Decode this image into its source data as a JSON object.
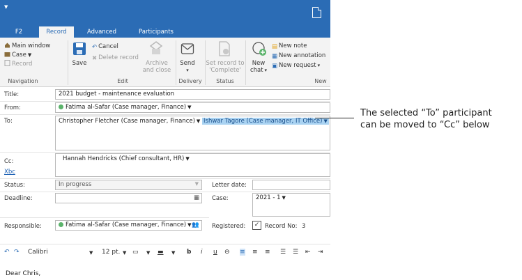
{
  "tabs": [
    {
      "label": "F2"
    },
    {
      "label": "Record"
    },
    {
      "label": "Advanced"
    },
    {
      "label": "Participants"
    }
  ],
  "ribbon": {
    "navigation": {
      "group_label": "Navigation",
      "main_window": "Main window",
      "case": "Case",
      "record": "Record"
    },
    "edit": {
      "group_label": "Edit",
      "save": "Save",
      "cancel": "Cancel",
      "delete_record": "Delete record",
      "archive_line1": "Archive",
      "archive_line2": "and close"
    },
    "delivery": {
      "group_label": "Delivery",
      "send": "Send"
    },
    "status": {
      "group_label": "Status",
      "set_line1": "Set record to",
      "set_line2": "'Complete'"
    },
    "new": {
      "group_label": "New",
      "new_chat_line1": "New",
      "new_chat_line2": "chat",
      "new_note": "New note",
      "new_annotation": "New annotation",
      "new_request": "New request"
    }
  },
  "form": {
    "title_label": "Title:",
    "title_value": "2021 budget - maintenance evaluation",
    "from_label": "From:",
    "from_value": "Fatima al-Safar (Case manager, Finance)",
    "to_label": "To:",
    "to_recipient_1": "Christopher Fletcher (Case manager, Finance)",
    "to_recipient_2": "Ishwar Tagore (Case manager, IT Office)",
    "cc_label": "Cc:",
    "cc_value": "Hannah Hendricks (Chief consultant, HR)",
    "xbc_label": "Xbc",
    "status_label": "Status:",
    "status_value": "In progress",
    "letter_date_label": "Letter date:",
    "deadline_label": "Deadline:",
    "case_label": "Case:",
    "case_value": "2021 - 1",
    "responsible_label": "Responsible:",
    "responsible_value": "Fatima al-Safar (Case manager, Finance)",
    "registered_label": "Registered:",
    "record_no_label": "Record No:",
    "record_no_value": "3"
  },
  "editor": {
    "font": "Calibri",
    "size": "12 pt.",
    "bold": "b",
    "italic": "i",
    "underline": "u",
    "body": "Dear Chris,"
  },
  "callout": {
    "line1": "The selected “To” participant",
    "line2": "can be moved to “Cc” below"
  },
  "colors": {
    "accent": "#2b6cb5",
    "selection": "#aad3f2",
    "status_dot": "#5bb36b"
  }
}
